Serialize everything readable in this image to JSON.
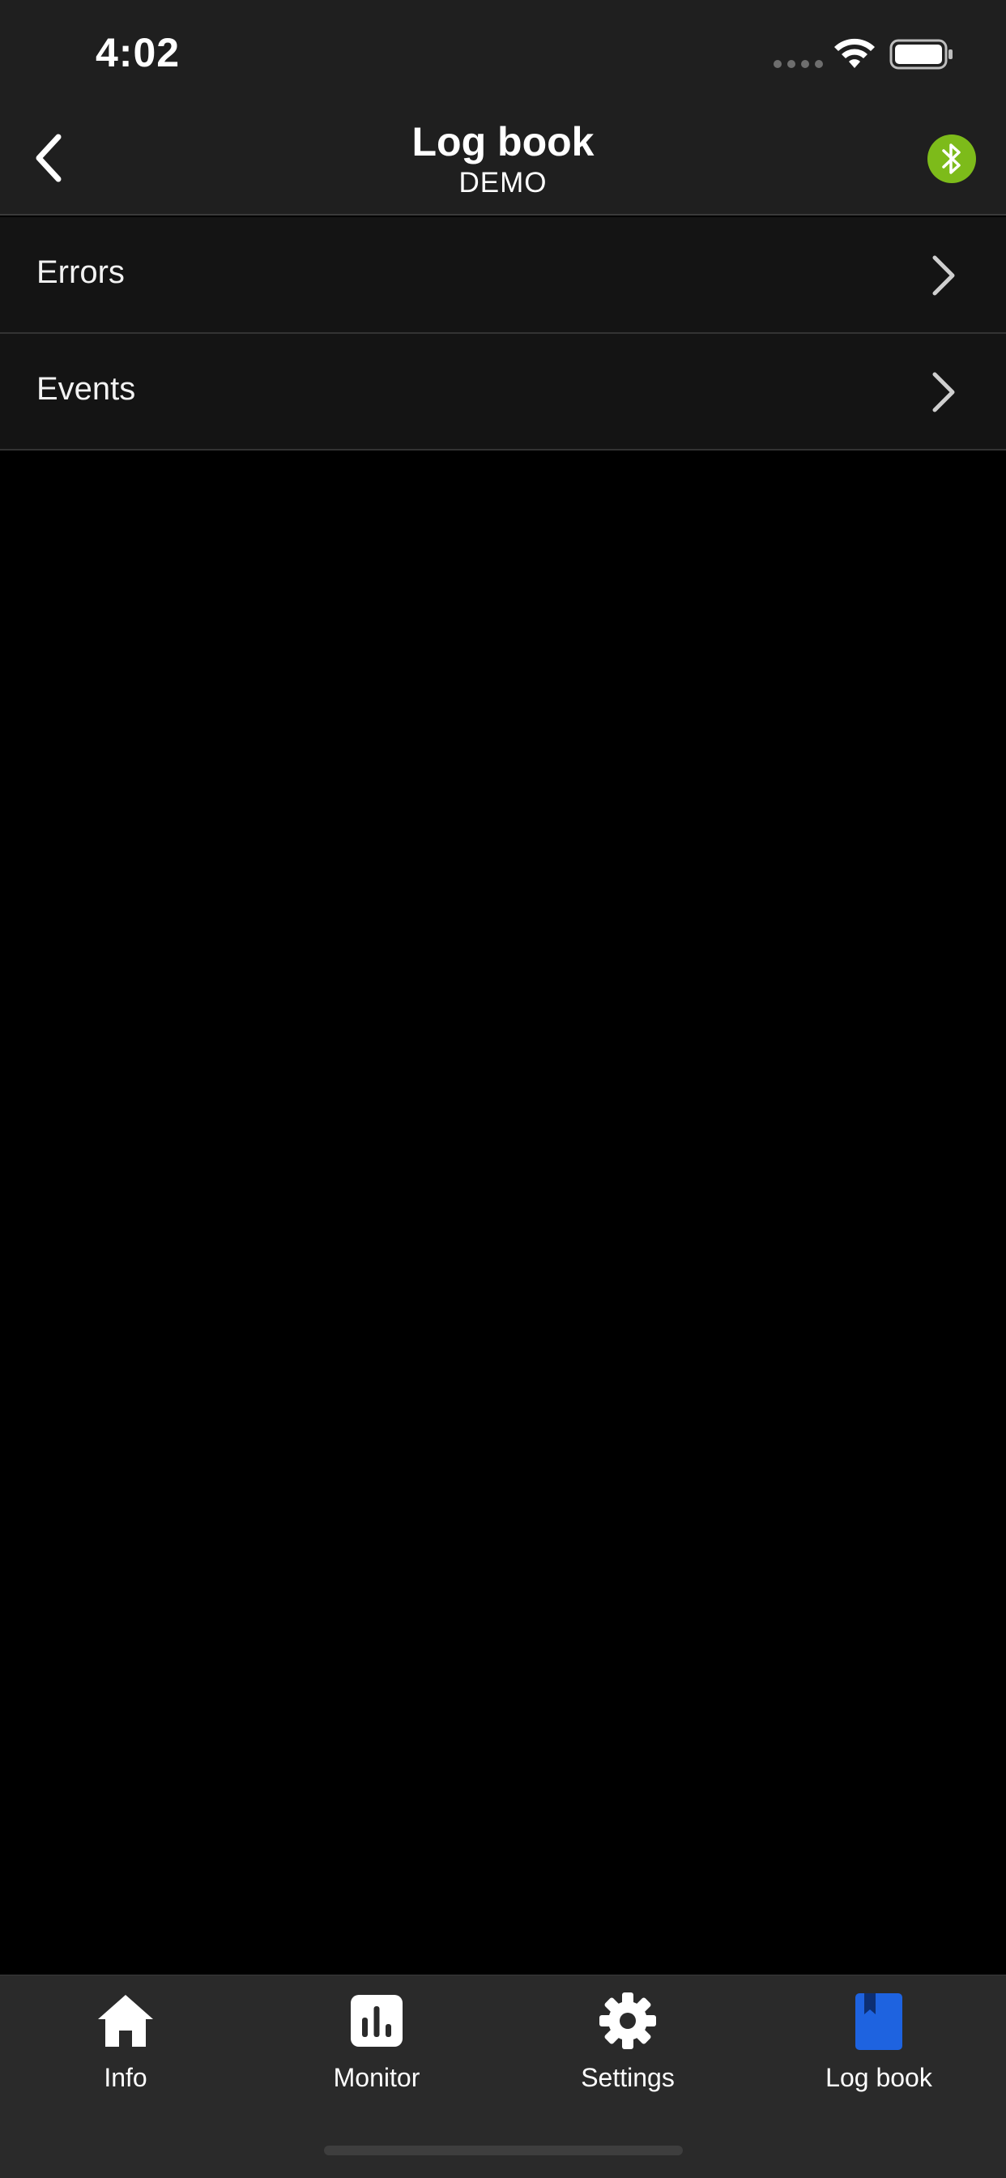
{
  "status_bar": {
    "time": "4:02"
  },
  "nav": {
    "title": "Log book",
    "subtitle": "DEMO",
    "bluetooth_color": "#7dbb1a"
  },
  "list": {
    "items": [
      {
        "label": "Errors"
      },
      {
        "label": "Events"
      }
    ]
  },
  "tab_bar": {
    "active_color": "#1e63e0",
    "tabs": [
      {
        "label": "Info",
        "icon": "home-icon",
        "active": false
      },
      {
        "label": "Monitor",
        "icon": "bar-chart-icon",
        "active": false
      },
      {
        "label": "Settings",
        "icon": "gear-icon",
        "active": false
      },
      {
        "label": "Log book",
        "icon": "bookmark-book-icon",
        "active": true
      }
    ]
  }
}
